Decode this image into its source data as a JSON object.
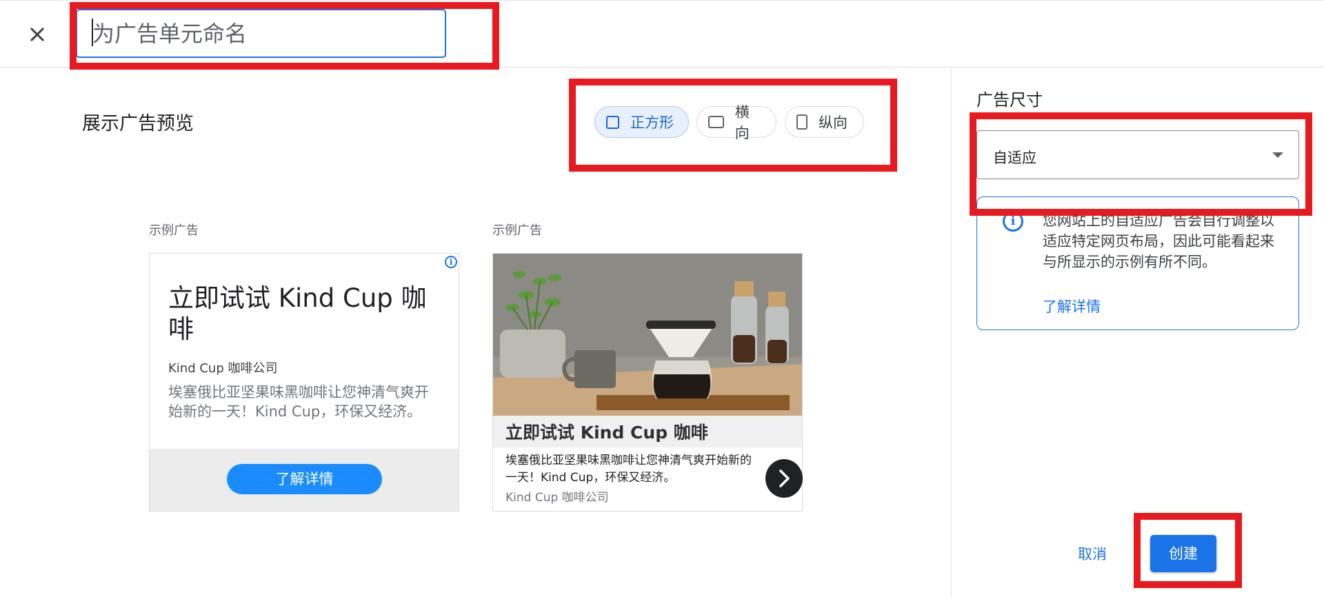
{
  "header": {
    "close_icon": "close-icon",
    "name_placeholder": "为广告单元命名",
    "name_value": ""
  },
  "preview": {
    "title": "展示广告预览",
    "shapes": [
      {
        "label": "正方形",
        "icon": "square-icon",
        "selected": true
      },
      {
        "label": "横向",
        "icon": "landscape-icon",
        "selected": false
      },
      {
        "label": "纵向",
        "icon": "portrait-icon",
        "selected": false
      }
    ],
    "ad1": {
      "label": "示例广告",
      "info_glyph": "i",
      "title": "立即试试 Kind Cup 咖啡",
      "company": "Kind Cup 咖啡公司",
      "description": "埃塞俄比亚坚果味黑咖啡让您神清气爽开始新的一天！Kind Cup，环保又经济。",
      "button": "了解详情"
    },
    "ad2": {
      "label": "示例广告",
      "title": "立即试试 Kind Cup 咖啡",
      "description": "埃塞俄比亚坚果味黑咖啡让您神清气爽开始新的一天！Kind Cup，环保又经济。",
      "company": "Kind Cup 咖啡公司",
      "next_icon": "chevron-right-icon"
    }
  },
  "panel": {
    "size_label": "广告尺寸",
    "size_value": "自适应",
    "info_glyph": "i",
    "info_text": "您网站上的自适应广告会自行调整以适应特定网页布局，因此可能看起来与所显示的示例有所不同。",
    "info_link": "了解详情",
    "cancel": "取消",
    "create": "创建"
  },
  "colors": {
    "accent": "#1a73e8",
    "highlight": "#e8191f",
    "ad_button": "#1a8cff"
  }
}
